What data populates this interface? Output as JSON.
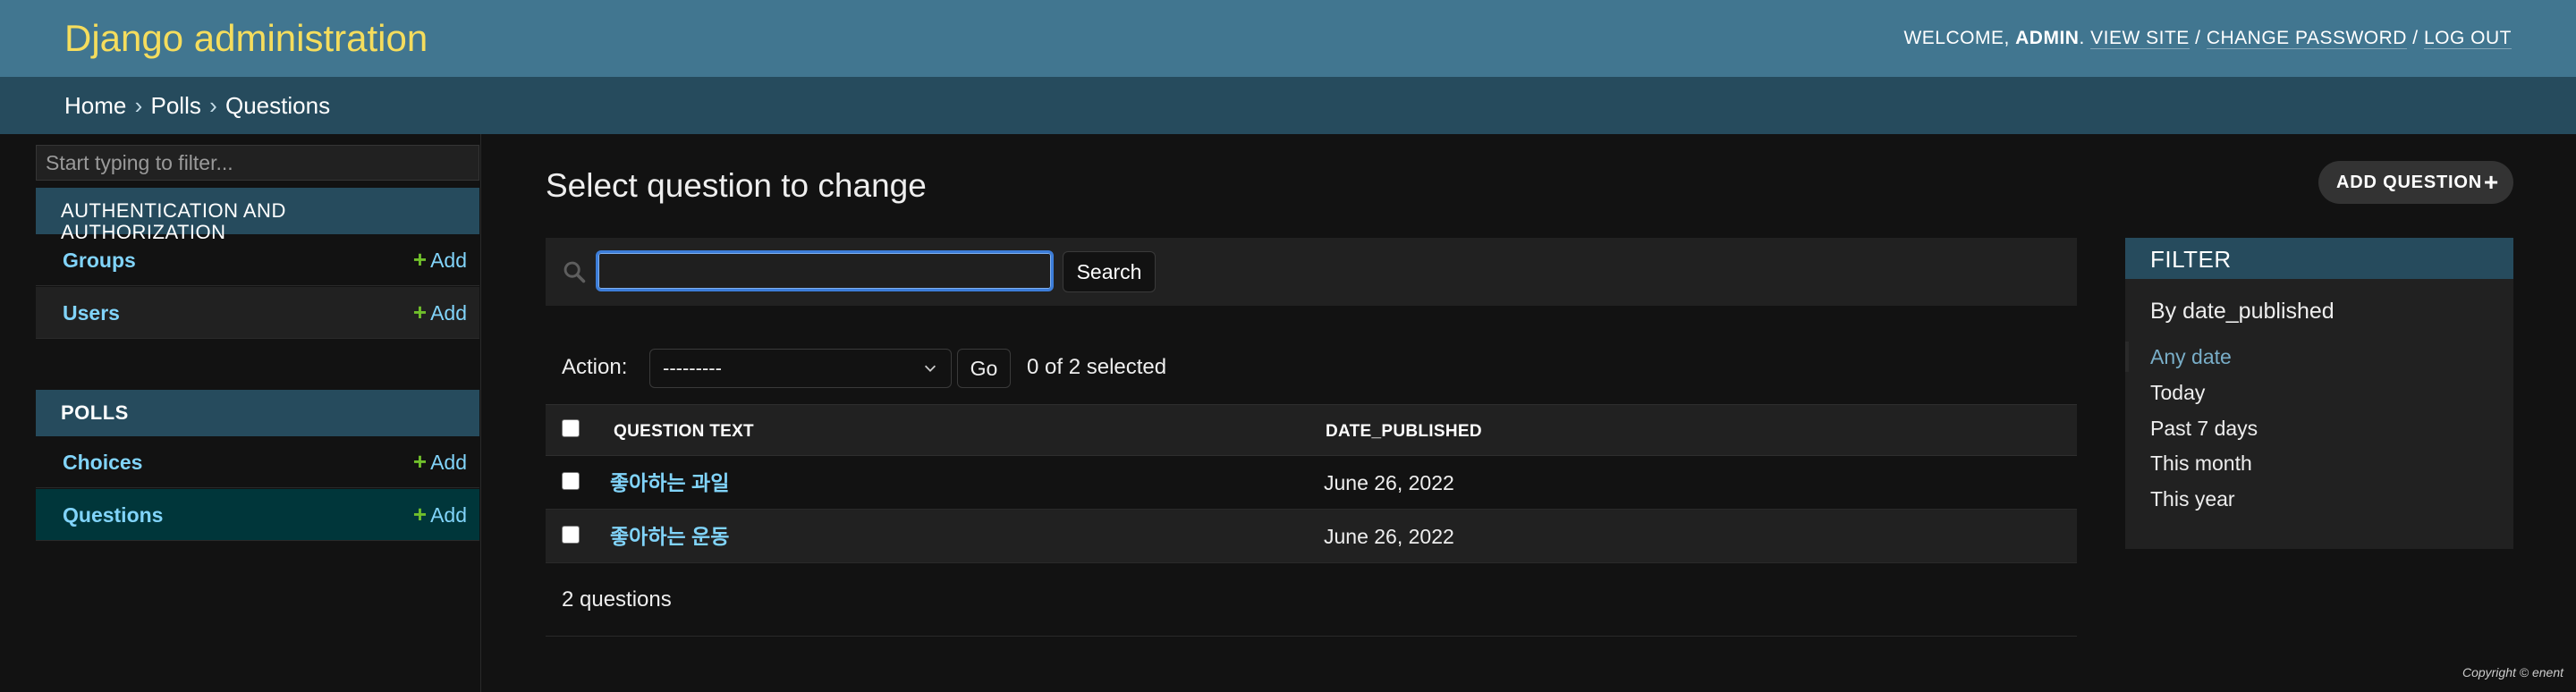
{
  "header": {
    "brand": "Django administration",
    "welcome": "WELCOME,",
    "username": "ADMIN",
    "view_site": "VIEW SITE",
    "change_password": "CHANGE PASSWORD",
    "log_out": "LOG OUT",
    "slash": " / "
  },
  "breadcrumbs": {
    "home": "Home",
    "app": "Polls",
    "current": "Questions",
    "sep": "›"
  },
  "sidebar": {
    "filter_placeholder": "Start typing to filter...",
    "modules": [
      {
        "caption": "AUTHENTICATION AND AUTHORIZATION",
        "models": [
          {
            "name": "Groups",
            "add": "Add"
          },
          {
            "name": "Users",
            "add": "Add"
          }
        ]
      },
      {
        "caption": "POLLS",
        "models": [
          {
            "name": "Choices",
            "add": "Add"
          },
          {
            "name": "Questions",
            "add": "Add"
          }
        ]
      }
    ],
    "add_symbol": "+"
  },
  "main": {
    "title": "Select question to change",
    "add_button": "ADD QUESTION",
    "search_button": "Search",
    "search_value": "",
    "action_label": "Action:",
    "action_selected": "---------",
    "go_button": "Go",
    "counter": "0 of 2 selected",
    "columns": [
      "QUESTION TEXT",
      "DATE_PUBLISHED"
    ],
    "rows": [
      {
        "question": "좋아하는 과일",
        "date": "June 26, 2022"
      },
      {
        "question": "좋아하는 운동",
        "date": "June 26, 2022"
      }
    ],
    "paginator": "2 questions"
  },
  "filter": {
    "title": "FILTER",
    "subtitle": "By date_published",
    "options": [
      "Any date",
      "Today",
      "Past 7 days",
      "This month",
      "This year"
    ],
    "selected_index": 0
  },
  "footer": {
    "copyright": "Copyright © enent"
  },
  "colors": {
    "header_bg": "#417690",
    "brand_yellow": "#f5dd5d",
    "breadcrumb_bg": "#264b5d",
    "link": "#81d4fa",
    "add_green": "#70bf2b",
    "selected_model_bg": "#00363a",
    "body_bg": "#121212"
  },
  "icons": {
    "search": "search-icon",
    "add": "plus-icon",
    "select_caret": "chevron-down-icon"
  }
}
